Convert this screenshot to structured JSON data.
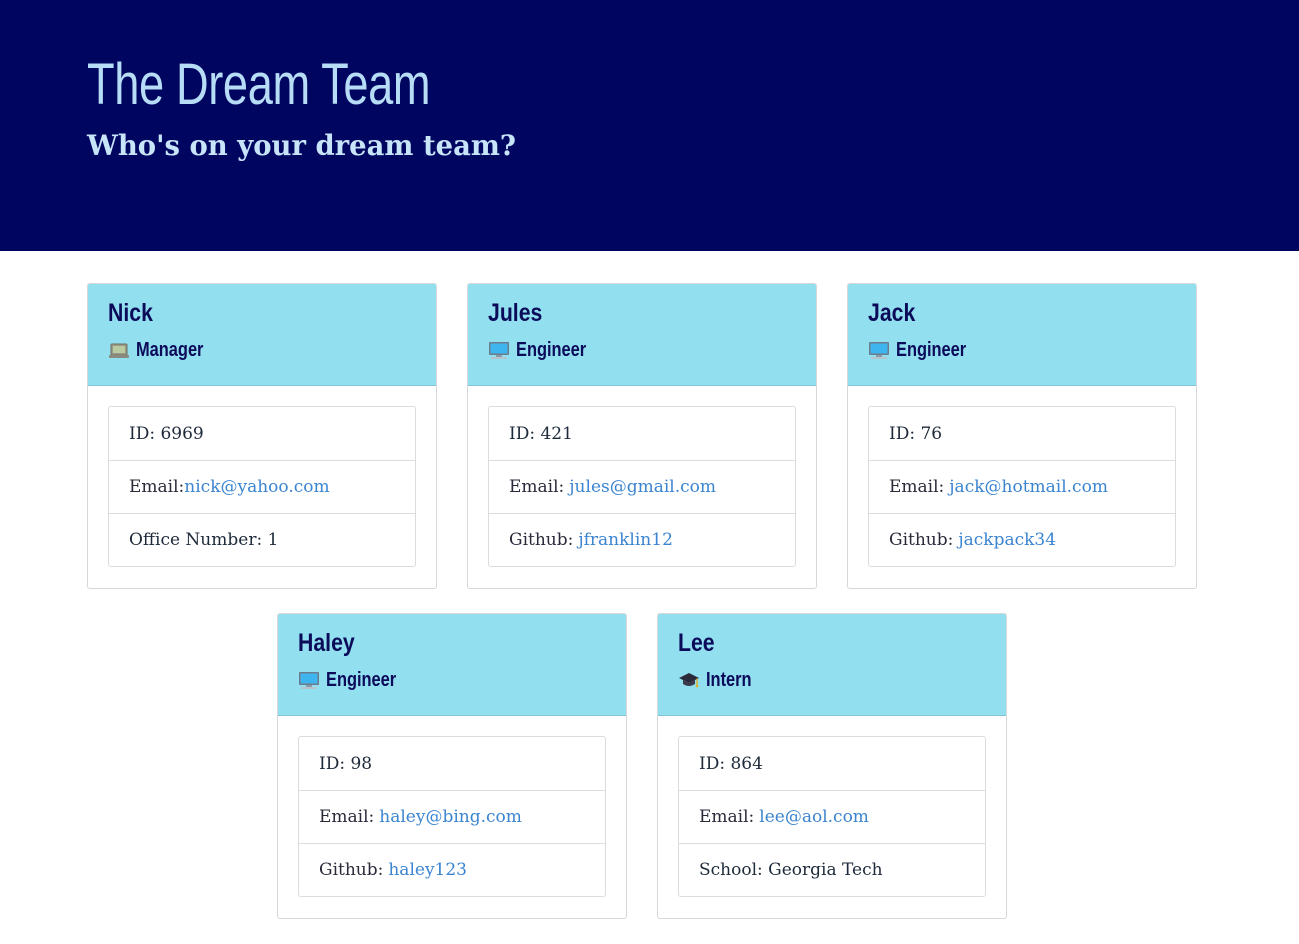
{
  "header": {
    "title": "The Dream Team",
    "subtitle": "Who's on your dream team?",
    "background_color": "#000560"
  },
  "cards": [
    {
      "name": "Nick",
      "role": "Manager",
      "role_icon": "laptop-icon",
      "id_label": "ID: 6969",
      "email_label": "Email:",
      "email": "nick@yahoo.com",
      "extra_label": "Office Number: 1",
      "extra_link": ""
    },
    {
      "name": "Jules",
      "role": "Engineer",
      "role_icon": "computer-icon",
      "id_label": "ID: 421",
      "email_label": "Email:",
      "email": "jules@gmail.com",
      "extra_label": "Github:",
      "extra_link": "jfranklin12"
    },
    {
      "name": "Jack",
      "role": "Engineer",
      "role_icon": "computer-icon",
      "id_label": "ID: 76",
      "email_label": "Email:",
      "email": "jack@hotmail.com",
      "extra_label": "Github:",
      "extra_link": "jackpack34"
    },
    {
      "name": "Haley",
      "role": "Engineer",
      "role_icon": "computer-icon",
      "id_label": "ID: 98",
      "email_label": "Email:",
      "email": "haley@bing.com",
      "extra_label": "Github:",
      "extra_link": "haley123"
    },
    {
      "name": "Lee",
      "role": "Intern",
      "role_icon": "graduation-cap-icon",
      "id_label": "ID: 864",
      "email_label": "Email:",
      "email": "lee@aol.com",
      "extra_label": "School: Georgia Tech",
      "extra_link": ""
    }
  ],
  "colors": {
    "card_header": "#92dfef",
    "link": "#3a84d0",
    "title": "#b6dcf6"
  }
}
